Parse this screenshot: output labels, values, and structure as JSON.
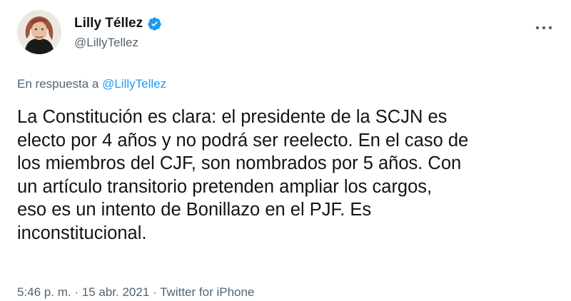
{
  "author": {
    "display_name": "Lilly Téllez",
    "handle": "@LillyTellez",
    "avatar_icon": "profile-photo",
    "verified_icon": "verified-badge-icon",
    "verified_color": "#1d9bf0"
  },
  "reply": {
    "prefix": "En respuesta a",
    "mention": "@LillyTellez"
  },
  "tweet": {
    "text": "La Constitución es clara: el presidente de la SCJN es\nelecto por 4 años y no podrá ser reelecto. En el caso de\nlos miembros del CJF, son nombrados por 5 años. Con\nun artículo transitorio pretenden ampliar los cargos,\neso es un intento de Bonillazo en el PJF. Es\ninconstitucional."
  },
  "meta": {
    "time": "5:46 p. m.",
    "separator": "·",
    "date": "15 abr. 2021",
    "source": "Twitter for iPhone"
  },
  "menu": {
    "icon": "more-options-icon"
  },
  "colors": {
    "text_primary": "#0f1419",
    "text_secondary": "#536471",
    "link": "#1d9bf0"
  }
}
